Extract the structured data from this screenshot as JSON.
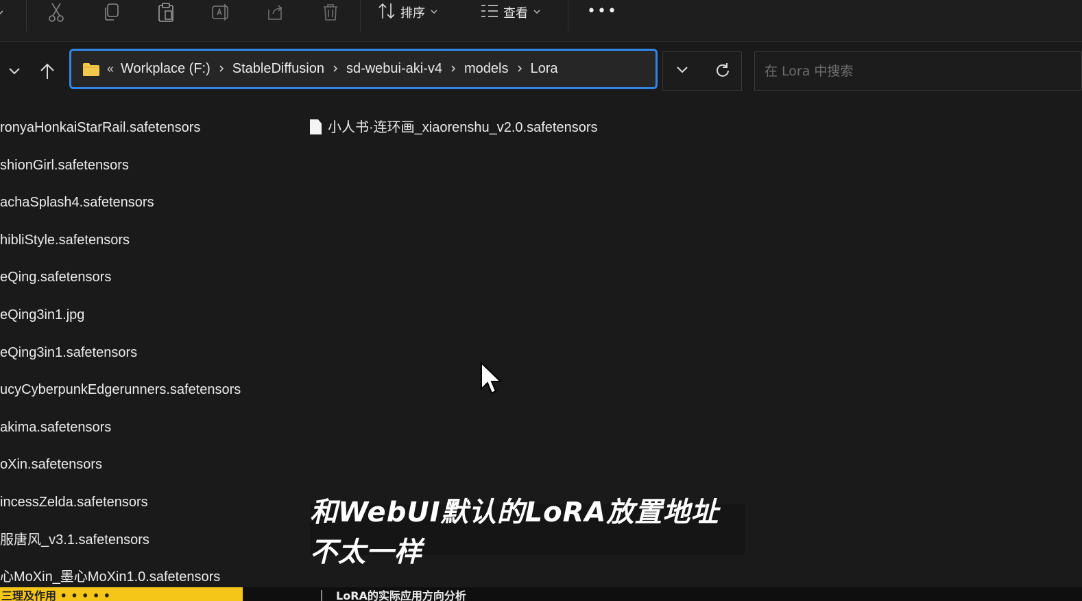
{
  "toolbar": {
    "icons": [
      "cut-icon",
      "copy-icon",
      "paste-icon",
      "rename-icon",
      "share-icon",
      "delete-icon"
    ],
    "sort_label": "排序",
    "view_label": "查看",
    "more_label": "•••"
  },
  "address_bar": {
    "overflow": "«",
    "crumbs": [
      "Workplace (F:)",
      "StableDiffusion",
      "sd-webui-aki-v4",
      "models",
      "Lora"
    ]
  },
  "search": {
    "placeholder": "在 Lora 中搜索"
  },
  "files_col1": [
    "ronyaHonkaiStarRail.safetensors",
    "shionGirl.safetensors",
    "achaSplash4.safetensors",
    "hibliStyle.safetensors",
    "eQing.safetensors",
    "eQing3in1.jpg",
    "eQing3in1.safetensors",
    "ucyCyberpunkEdgerunners.safetensors",
    "akima.safetensors",
    "oXin.safetensors",
    "incessZelda.safetensors",
    "服唐风_v3.1.safetensors",
    "心MoXin_墨心MoXin1.0.safetensors"
  ],
  "files_col2": [
    "小人书·连环画_xiaorenshu_v2.0.safetensors"
  ],
  "subtitle": "和WebUI默认的LoRA放置地址不太一样",
  "bottom": {
    "left": "三理及作用  •  •  •  •  •  ",
    "right": "LoRA的实际应用方向分析"
  },
  "colors": {
    "accent": "#2f86e6",
    "folder": "#f2c94c",
    "highlight": "#f5c518"
  }
}
